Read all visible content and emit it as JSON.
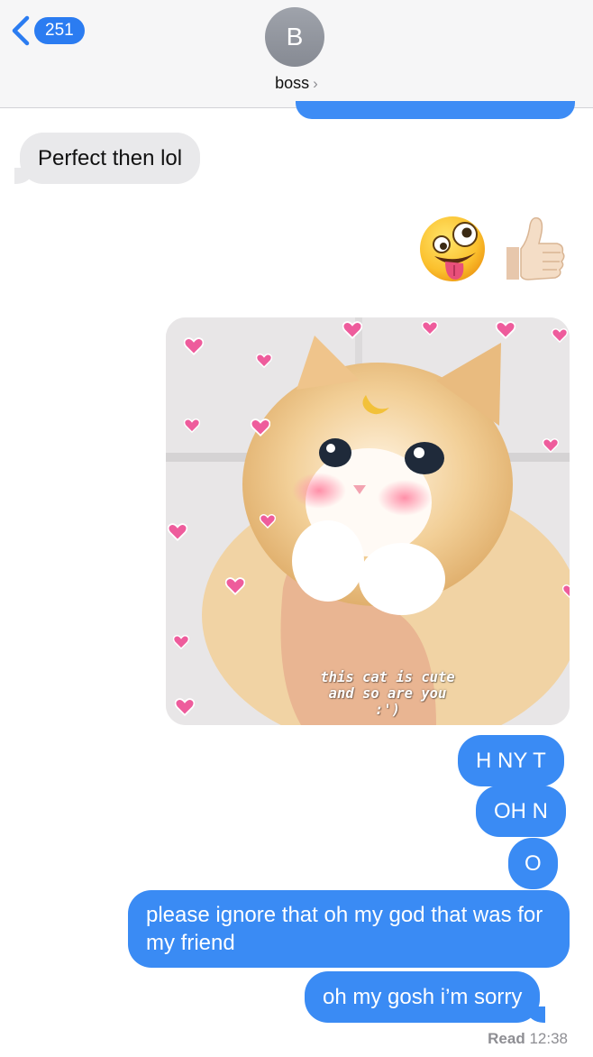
{
  "header": {
    "unread_count": "251",
    "avatar_initial": "B",
    "contact_name": "boss",
    "contact_arrow": "›"
  },
  "messages": {
    "m1": "Perfect then lol",
    "m2": "H NY T",
    "m3": "OH N",
    "m4": "O",
    "m5": "please ignore that oh my god that was for my friend",
    "m6": "oh my gosh i’m sorry"
  },
  "emojis": {
    "zany_face": "zany-face",
    "thumbs_up": "thumbs-up"
  },
  "photo": {
    "caption": "this cat is cute\nand so are you\n:')"
  },
  "status": {
    "read_label": "Read",
    "read_time": "12:38"
  },
  "colors": {
    "sent_bubble": "#3a8bf4",
    "received_bubble": "#e9e9eb",
    "badge": "#2b7cf1"
  }
}
